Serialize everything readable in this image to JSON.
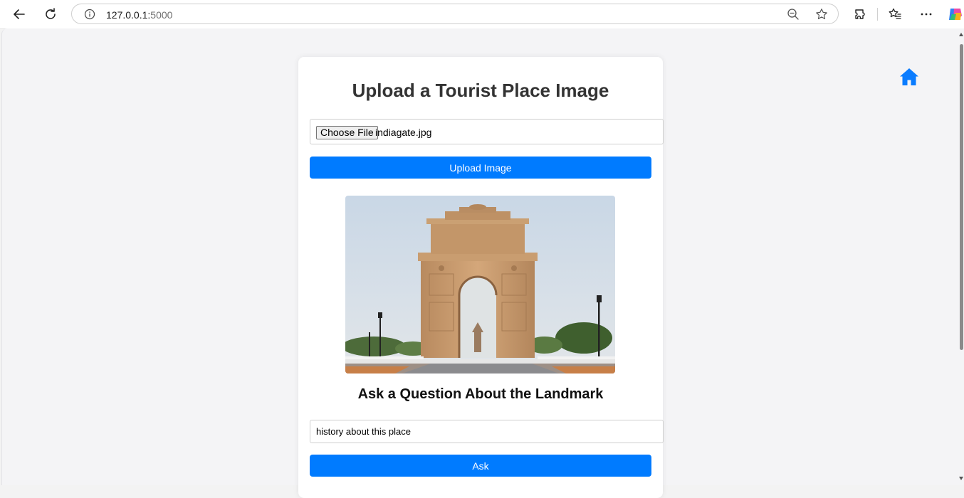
{
  "browser": {
    "url_host": "127.0.0.1:",
    "url_port": "5000"
  },
  "page": {
    "title": "Upload a Tourist Place Image",
    "file_input": {
      "button_label": "Choose File",
      "file_name": "indiagate.jpg"
    },
    "upload_button": "Upload Image",
    "image_alt": "indiagate.jpg",
    "question_heading": "Ask a Question About the Landmark",
    "question_input": {
      "value": "history about this place"
    },
    "ask_button": "Ask"
  },
  "colors": {
    "accent": "#007bff",
    "home_icon": "#0a7cff",
    "page_bg": "#f4f4f6",
    "card_bg": "#ffffff"
  },
  "icons": [
    "back-icon",
    "reload-icon",
    "info-icon",
    "zoom-out-icon",
    "favorite-star-icon",
    "extensions-icon",
    "favorites-icon",
    "more-icon",
    "copilot-icon",
    "home-icon"
  ]
}
